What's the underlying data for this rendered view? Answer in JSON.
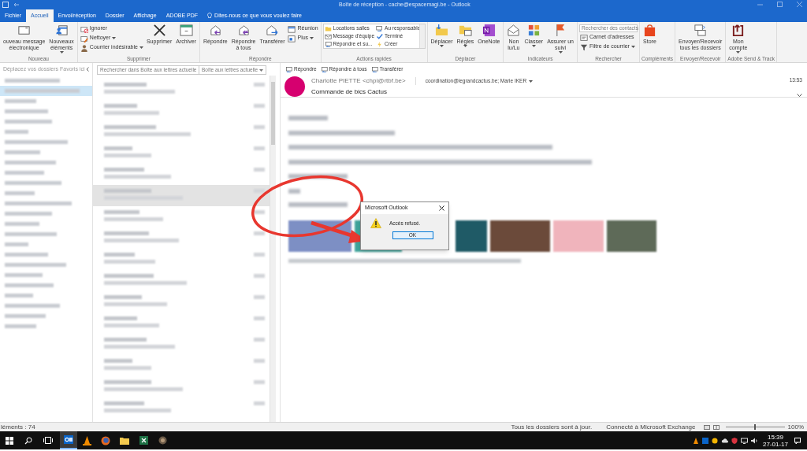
{
  "window": {
    "title": "Boîte de réception - cache@espacemagi.be - Outlook"
  },
  "tabs": [
    {
      "label": "Fichier",
      "selected": false
    },
    {
      "label": "Accueil",
      "selected": true
    },
    {
      "label": "Envoi/réception",
      "selected": false
    },
    {
      "label": "Dossier",
      "selected": false
    },
    {
      "label": "Affichage",
      "selected": false
    },
    {
      "label": "ADOBE PDF",
      "selected": false
    }
  ],
  "tell_me": {
    "placeholder": "Dites-nous ce que vous voulez faire"
  },
  "ribbon_groups": [
    {
      "name": "Nouveau",
      "items": [
        {
          "kind": "large",
          "label": "ouveau message\nélectronique",
          "dropdown": false
        },
        {
          "kind": "large",
          "label": "Nouveaux\néléments",
          "dropdown": true
        }
      ]
    },
    {
      "name": "Supprimer",
      "items": [
        {
          "kind": "stack",
          "entries": [
            {
              "label": "Ignorer",
              "dropdown": false
            },
            {
              "label": "Nettoyer",
              "dropdown": true
            },
            {
              "label": "Courrier indésirable",
              "dropdown": true
            }
          ]
        },
        {
          "kind": "large",
          "label": "Supprimer",
          "dropdown": false
        },
        {
          "kind": "large",
          "label": "Archiver",
          "dropdown": false
        }
      ]
    },
    {
      "name": "Répondre",
      "items": [
        {
          "kind": "large",
          "label": "Répondre",
          "dropdown": false
        },
        {
          "kind": "large",
          "label": "Répondre\nà tous",
          "dropdown": false
        },
        {
          "kind": "large",
          "label": "Transférer",
          "dropdown": false
        },
        {
          "kind": "stack",
          "entries": [
            {
              "label": "Réunion",
              "dropdown": false
            },
            {
              "label": "Plus",
              "dropdown": true
            }
          ]
        }
      ]
    },
    {
      "name": "Actions rapides",
      "items": [
        {
          "kind": "gallery",
          "entries": [
            {
              "label": "Locations salles"
            },
            {
              "label": "Message d'équipe"
            },
            {
              "label": "Répondre et su..."
            },
            {
              "label": "Au responsable"
            },
            {
              "label": "Terminé"
            },
            {
              "label": "Créer"
            }
          ]
        }
      ]
    },
    {
      "name": "Déplacer",
      "items": [
        {
          "kind": "large",
          "label": "Déplacer",
          "dropdown": true
        },
        {
          "kind": "large",
          "label": "Règles",
          "dropdown": true
        },
        {
          "kind": "large",
          "label": "OneNote",
          "dropdown": false
        }
      ]
    },
    {
      "name": "Indicateurs",
      "items": [
        {
          "kind": "large",
          "label": "Non\nlu/Lu",
          "dropdown": false
        },
        {
          "kind": "large",
          "label": "Classer",
          "dropdown": true
        },
        {
          "kind": "large",
          "label": "Assurer un\nsuivi",
          "dropdown": true
        }
      ]
    },
    {
      "name": "Rechercher",
      "items": [
        {
          "kind": "stack",
          "search": {
            "placeholder": "Rechercher des contacts"
          },
          "entries": [
            {
              "label": "Carnet d'adresses",
              "dropdown": false
            },
            {
              "label": "Filtre de courrier",
              "dropdown": true
            }
          ]
        }
      ]
    },
    {
      "name": "Compléments",
      "items": [
        {
          "kind": "large",
          "label": "Store",
          "dropdown": false
        }
      ]
    },
    {
      "name": "Envoyer/Recevoir",
      "items": [
        {
          "kind": "large",
          "label": "Envoyer/Recevoir\ntous les dossiers",
          "dropdown": false
        }
      ]
    },
    {
      "name": "Adobe Send & Track",
      "items": [
        {
          "kind": "large",
          "label": "Mon\ncompte",
          "dropdown": true
        }
      ]
    }
  ],
  "folder_pane": {
    "hint": "Déplacez vos dossiers Favoris ici",
    "rows": [
      {
        "selected": false
      },
      {
        "selected": true
      },
      {
        "selected": false
      },
      {
        "selected": false
      },
      {
        "selected": false
      },
      {
        "selected": false
      },
      {
        "selected": false
      },
      {
        "selected": false
      },
      {
        "selected": false
      },
      {
        "selected": false
      },
      {
        "selected": false
      },
      {
        "selected": false
      },
      {
        "selected": false
      },
      {
        "selected": false
      },
      {
        "selected": false
      },
      {
        "selected": false
      },
      {
        "selected": false
      },
      {
        "selected": false
      },
      {
        "selected": false
      },
      {
        "selected": false
      },
      {
        "selected": false
      },
      {
        "selected": false
      },
      {
        "selected": false
      },
      {
        "selected": false
      },
      {
        "selected": false
      }
    ]
  },
  "message_list": {
    "search": {
      "placeholder": "Rechercher dans Boîte aux lettres actuelle"
    },
    "scope": "Boîte aux lettres actuelle",
    "rows": [
      {
        "selected": false
      },
      {
        "selected": false
      },
      {
        "selected": false
      },
      {
        "selected": false
      },
      {
        "selected": false
      },
      {
        "selected": true
      },
      {
        "selected": false
      },
      {
        "selected": false
      },
      {
        "selected": false
      },
      {
        "selected": false
      },
      {
        "selected": false
      },
      {
        "selected": false
      },
      {
        "selected": false
      },
      {
        "selected": false
      },
      {
        "selected": false
      },
      {
        "selected": false
      }
    ]
  },
  "reading_pane": {
    "actions": [
      "Répondre",
      "Répondre à tous",
      "Transférer"
    ],
    "sender": "Charlotte PIETTE <chpi@rtbf.be>",
    "recipients": "coordination@legrandcactus.be; Marie IKER",
    "time": "13:53",
    "subject": "Commande de bics Cactus"
  },
  "dialog": {
    "title": "Microsoft Outlook",
    "message": "Accès refusé.",
    "button": "OK"
  },
  "status_bar": {
    "items_count": "léments : 74",
    "sync": "Tous les dossiers sont à jour.",
    "connection": "Connecté à Microsoft Exchange",
    "zoom_slider": {
      "level": 0.5
    },
    "zoom": "100%"
  },
  "taskbar": {
    "time": "15:39",
    "date": "27-01-17"
  }
}
